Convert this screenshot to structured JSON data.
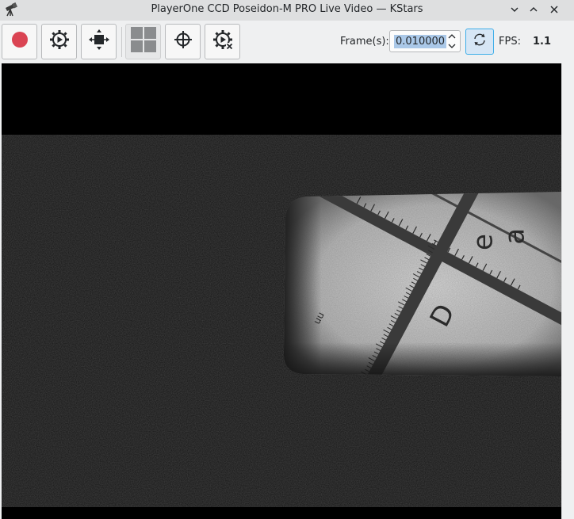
{
  "window": {
    "title": "PlayerOne CCD Poseidon-M PRO Live Video — KStars",
    "app_icon": "telescope-icon",
    "controls": [
      "minimize-icon",
      "maximize-icon",
      "close-icon"
    ]
  },
  "toolbar": {
    "buttons": [
      {
        "name": "record-button",
        "icon": "record-icon"
      },
      {
        "name": "stream-options-button",
        "icon": "gear-play-icon"
      },
      {
        "name": "subframe-button",
        "icon": "subframe-icon"
      },
      {
        "name": "grid-button",
        "icon": "grid-icon"
      },
      {
        "name": "crosshair-button",
        "icon": "crosshair-icon"
      },
      {
        "name": "stop-stream-button",
        "icon": "gear-stop-icon"
      }
    ],
    "frame_label": "Frame(s):",
    "frame_value": "0.010000",
    "sync_icon": "refresh-icon",
    "fps_label": "FPS:",
    "fps_value": "1.1"
  },
  "colors": {
    "record": "#da4453",
    "accent": "#3daee9"
  },
  "video": {
    "description_icon": "live-video-frame"
  }
}
